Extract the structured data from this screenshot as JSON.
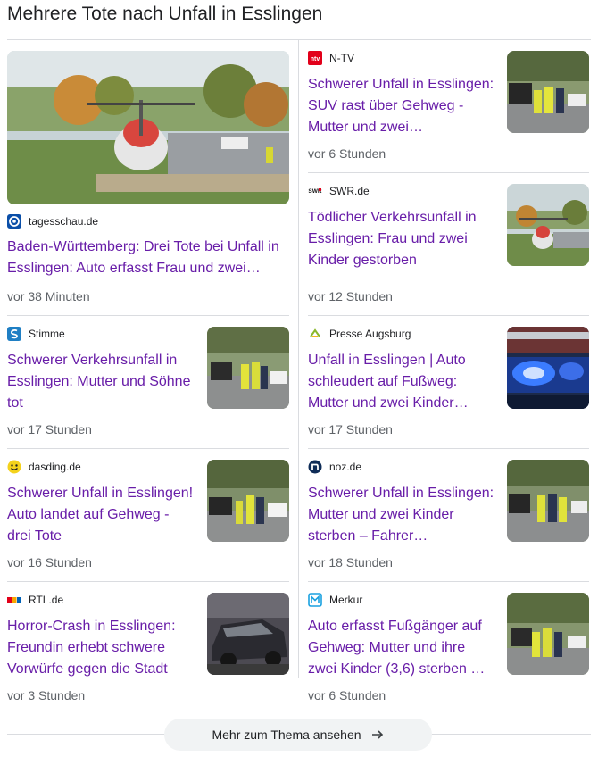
{
  "section_title": "Mehrere Tote nach Unfall in Esslingen",
  "more_button": "Mehr zum Thema ansehen",
  "left": [
    {
      "source": "tagesschau.de",
      "logo_icon": "tagesschau-logo-icon",
      "headline": "Baden-Württemberg: Drei Tote bei Unfall in Esslingen: Auto erfasst Frau und zwei…",
      "time": "vor 38 Minuten",
      "image": "helicopter-scene-photo"
    },
    {
      "source": "Stimme",
      "logo_icon": "stimme-logo-icon",
      "headline": "Schwerer Verkehrsunfall in Esslingen: Mutter und Söhne tot",
      "time": "vor 17 Stunden",
      "image": "police-scene-photo"
    },
    {
      "source": "dasding.de",
      "logo_icon": "dasding-logo-icon",
      "headline": "Schwerer Unfall in Esslingen! Auto landet auf Gehweg - drei Tote",
      "time": "vor 16 Stunden",
      "image": "police-scene-photo"
    },
    {
      "source": "RTL.de",
      "logo_icon": "rtl-logo-icon",
      "headline": "Horror-Crash in Esslingen: Freundin erhebt schwere Vorwürfe gegen die Stadt",
      "time": "vor 3 Stunden",
      "image": "wrecked-car-photo"
    }
  ],
  "right": [
    {
      "source": "N-TV",
      "logo_icon": "ntv-logo-icon",
      "headline": "Schwerer Unfall in Esslingen: SUV rast über Gehweg - Mutter und zwei…",
      "time": "vor 6 Stunden",
      "image": "police-scene-photo"
    },
    {
      "source": "SWR.de",
      "logo_icon": "swr-logo-icon",
      "headline": "Tödlicher Verkehrsunfall in Esslingen: Frau und zwei Kinder gestorben",
      "time": "vor 12 Stunden",
      "image": "helicopter-scene-photo"
    },
    {
      "source": "Presse Augsburg",
      "logo_icon": "presse-augsburg-logo-icon",
      "headline": "Unfall in Esslingen | Auto schleudert auf Fußweg: Mutter und zwei Kinder…",
      "time": "vor 17 Stunden",
      "image": "police-lights-photo"
    },
    {
      "source": "noz.de",
      "logo_icon": "noz-logo-icon",
      "headline": "Schwerer Unfall in Esslingen: Mutter und zwei Kinder sterben – Fahrer…",
      "time": "vor 18 Stunden",
      "image": "police-scene-photo"
    },
    {
      "source": "Merkur",
      "logo_icon": "merkur-logo-icon",
      "headline": "Auto erfasst Fußgänger auf Gehweg: Mutter und ihre zwei Kinder (3,6) sterben …",
      "time": "vor 6 Stunden",
      "image": "police-scene-photo"
    }
  ]
}
